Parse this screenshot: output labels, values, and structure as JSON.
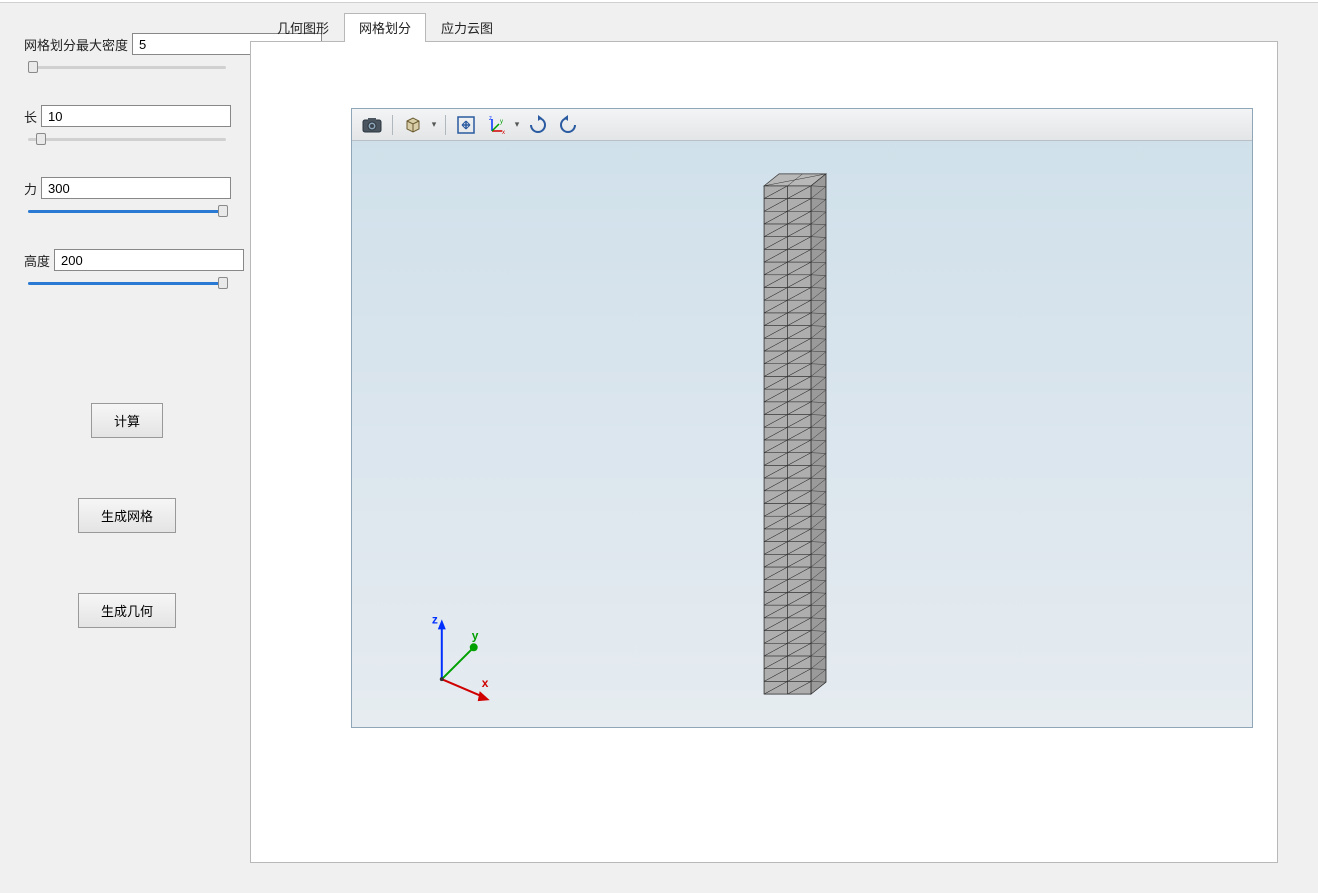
{
  "sidebar": {
    "fields": [
      {
        "label": "网格划分最大密度",
        "value": "5",
        "slider_pos": 0.02,
        "filled": false
      },
      {
        "label": "长",
        "value": "10",
        "slider_pos": 0.06,
        "filled": false
      },
      {
        "label": "力",
        "value": "300",
        "slider_pos": 0.97,
        "filled": true
      },
      {
        "label": "高度",
        "value": "200",
        "slider_pos": 0.97,
        "filled": true
      }
    ],
    "buttons": {
      "calculate": "计算",
      "gen_mesh": "生成网格",
      "gen_geom": "生成几何"
    }
  },
  "tabs": [
    {
      "label": "几何图形",
      "active": false
    },
    {
      "label": "网格划分",
      "active": true
    },
    {
      "label": "应力云图",
      "active": false
    }
  ],
  "viewport": {
    "toolbar_icons": [
      "camera",
      "cube",
      "fit",
      "axes",
      "rotate-cw",
      "rotate-ccw"
    ],
    "axis_labels": {
      "x": "x",
      "y": "y",
      "z": "z"
    }
  }
}
